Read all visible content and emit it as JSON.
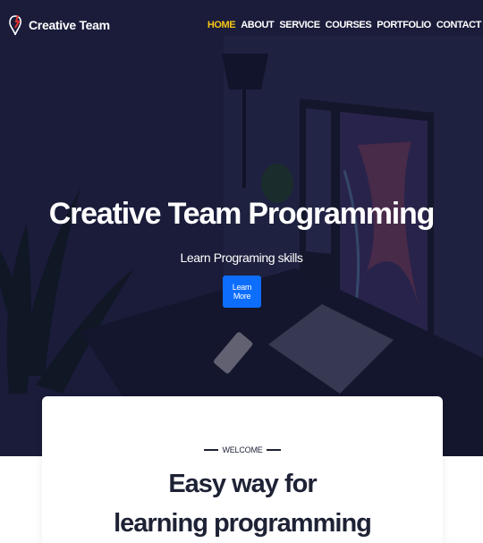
{
  "brand": {
    "name": "Creative Team",
    "icon": "brand-logo-icon"
  },
  "nav": {
    "items": [
      {
        "label": "HOME",
        "active": true
      },
      {
        "label": "ABOUT"
      },
      {
        "label": "SERVICE"
      },
      {
        "label": "COURSES"
      },
      {
        "label": "PORTFOLIO"
      },
      {
        "label": "CONTACT"
      }
    ],
    "active_color": "#f5c518"
  },
  "hero": {
    "title": "Creative Team Programming",
    "subtitle": "Learn Programing skills",
    "button_label": "Learn More",
    "button_color": "#0d6efd"
  },
  "welcome": {
    "eyebrow": "WELCOME",
    "title_line1": "Easy way for",
    "title_line2": "learning programming"
  }
}
